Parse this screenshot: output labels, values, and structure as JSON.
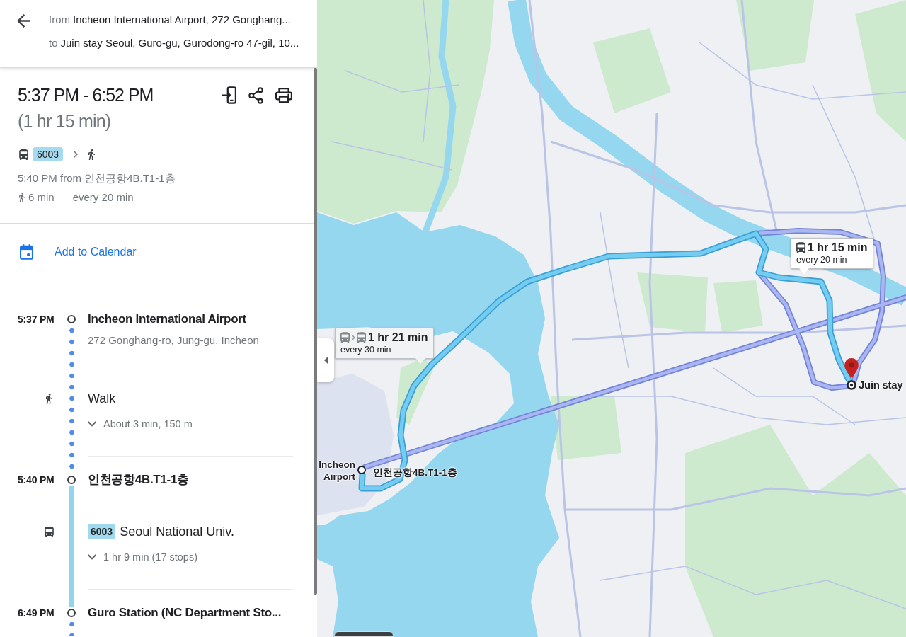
{
  "header": {
    "from": {
      "prefix": "from",
      "text": "Incheon International Airport, 272 Gonghang..."
    },
    "to": {
      "prefix": "to",
      "text": "Juin stay Seoul, Guro-gu, Gurodong-ro 47-gil, 10..."
    }
  },
  "summary": {
    "time_range": "5:37 PM - 6:52 PM",
    "duration": "(1 hr 15 min)",
    "steps": [
      {
        "kind": "bus",
        "line": "6003"
      },
      {
        "kind": "walk"
      }
    ],
    "departure": "5:40 PM from 인천공항4B.T1-1층",
    "walk_time": "6 min",
    "frequency": "every 20 min"
  },
  "calendar_link": {
    "label": "Add to Calendar"
  },
  "timeline": [
    {
      "kind": "stop",
      "time": "5:37 PM",
      "title": "Incheon International Airport",
      "address": "272 Gonghang-ro, Jung-gu, Incheon"
    },
    {
      "kind": "walk",
      "title": "Walk",
      "details": "About 3 min, 150 m",
      "expanded": false
    },
    {
      "kind": "stop",
      "time": "5:40 PM",
      "title": "인천공항4B.T1-1층"
    },
    {
      "kind": "bus",
      "line": "6003",
      "title": "Seoul National Univ.",
      "details": "1 hr 9 min (17 stops)",
      "expanded": false
    },
    {
      "kind": "stop",
      "time": "6:49 PM",
      "title": "Guro Station (NC Department Sto..."
    }
  ],
  "map": {
    "routes": [
      {
        "selected": true,
        "modes": [
          {
            "kind": "bus"
          }
        ],
        "duration": "1 hr 15 min",
        "frequency": "every 20 min"
      },
      {
        "selected": false,
        "modes": [
          {
            "kind": "bus"
          },
          {
            "kind": "bus"
          }
        ],
        "duration": "1 hr 21 min",
        "frequency": "every 30 min"
      }
    ],
    "origin_label": "Incheon Airport",
    "stop_label": "인천공항4B.T1-1층",
    "destination_label": "Juin stay"
  }
}
